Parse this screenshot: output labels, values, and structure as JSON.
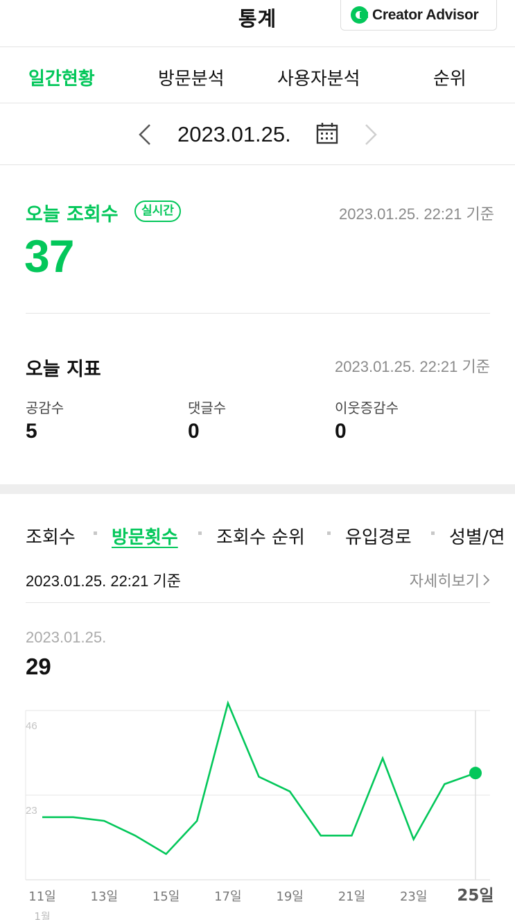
{
  "header": {
    "title": "통계",
    "creator_advisor_label": "Creator Advisor"
  },
  "tabs": [
    {
      "label": "일간현황",
      "active": true
    },
    {
      "label": "방문분석",
      "active": false
    },
    {
      "label": "사용자분석",
      "active": false
    },
    {
      "label": "순위",
      "active": false
    }
  ],
  "date_selector": {
    "date": "2023.01.25.",
    "prev_icon": "chevron-left-icon",
    "calendar_icon": "calendar-icon",
    "next_icon": "chevron-right-icon"
  },
  "today_views": {
    "label": "오늘 조회수",
    "badge": "실시간",
    "timestamp": "2023.01.25. 22:21 기준",
    "count": "37"
  },
  "today_indicators": {
    "title": "오늘 지표",
    "timestamp": "2023.01.25. 22:21 기준",
    "items": [
      {
        "label": "공감수",
        "value": "5"
      },
      {
        "label": "댓글수",
        "value": "0"
      },
      {
        "label": "이웃증감수",
        "value": "0"
      }
    ]
  },
  "chart_tabs": [
    {
      "label": "조회수",
      "active": false
    },
    {
      "label": "방문횟수",
      "active": true
    },
    {
      "label": "조회수 순위",
      "active": false
    },
    {
      "label": "유입경로",
      "active": false
    },
    {
      "label": "성별/연",
      "active": false
    }
  ],
  "chart_section": {
    "basis": "2023.01.25. 22:21 기준",
    "more_label": "자세히보기",
    "selected_date": "2023.01.25.",
    "selected_value": "29",
    "month_label": "1월"
  },
  "colors": {
    "accent": "#03c75a",
    "grid": "#e6e6e6",
    "muted_text": "#8a8a8a"
  },
  "chart_data": {
    "type": "line",
    "title": "",
    "xlabel": "",
    "ylabel": "",
    "x": [
      "11일",
      "12일",
      "13일",
      "14일",
      "15일",
      "16일",
      "17일",
      "18일",
      "19일",
      "20일",
      "21일",
      "22일",
      "23일",
      "24일",
      "25일"
    ],
    "x_tick_labels": [
      "11일",
      "",
      "13일",
      "",
      "15일",
      "",
      "17일",
      "",
      "19일",
      "",
      "21일",
      "",
      "23일",
      "",
      "25일"
    ],
    "series": [
      {
        "values": [
          17,
          17,
          16,
          12,
          7,
          16,
          48,
          28,
          24,
          12,
          12,
          33,
          11,
          26,
          29
        ]
      }
    ],
    "y_ticks": [
      23,
      46
    ],
    "ylim": [
      0,
      46
    ],
    "grid": true,
    "highlight_index": 14
  }
}
